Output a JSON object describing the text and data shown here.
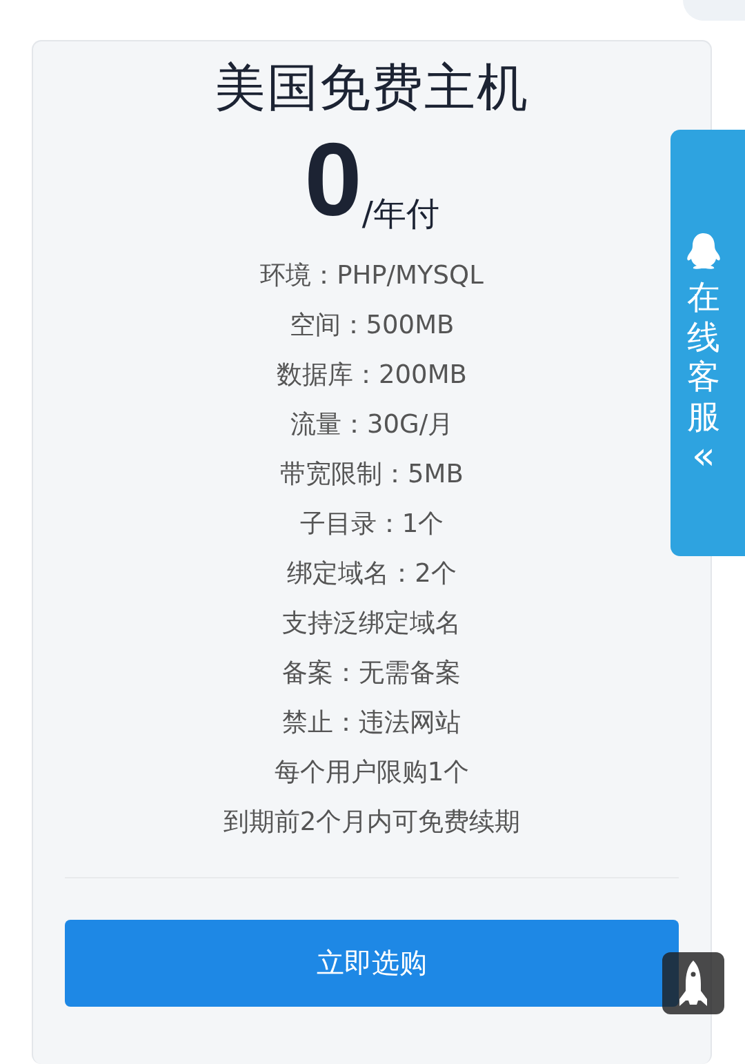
{
  "plan": {
    "title": "美国免费主机",
    "price": "0",
    "price_unit": "/年付",
    "features": [
      "环境：PHP/MYSQL",
      "空间：500MB",
      "数据库：200MB",
      "流量：30G/月",
      "带宽限制：5MB",
      "子目录：1个",
      "绑定域名：2个",
      "支持泛绑定域名",
      "备案：无需备案",
      "禁止：违法网站",
      "每个用户限购1个",
      "到期前2个月内可免费续期"
    ],
    "button": "立即选购"
  },
  "side_tab": {
    "label": "在线客服",
    "chevron": "«"
  }
}
